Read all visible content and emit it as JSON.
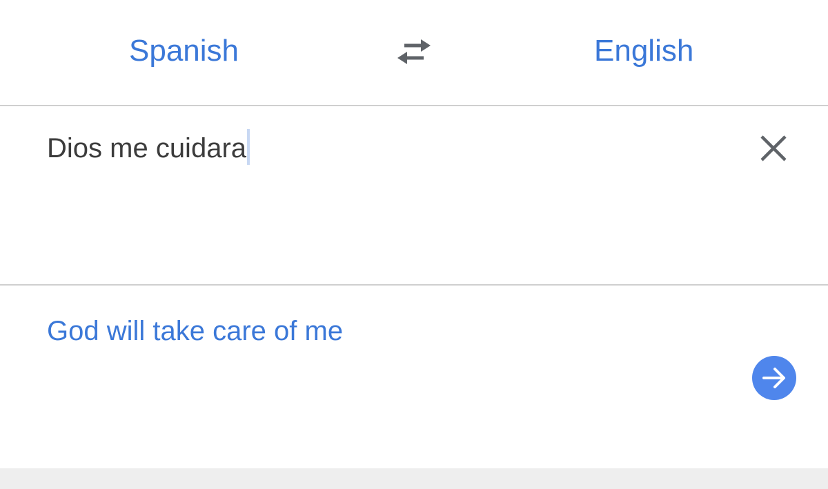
{
  "languages": {
    "source": "Spanish",
    "target": "English"
  },
  "icons": {
    "swap": "swap-arrows-icon",
    "clear": "close-icon",
    "go": "arrow-right-icon"
  },
  "input": {
    "value": "Dios me cuidara"
  },
  "output": {
    "translation": "God will take care of me"
  },
  "colors": {
    "accent": "#3b78d8",
    "go_button": "#4f86ec",
    "input_text": "#3c3c3c",
    "icon_gray": "#5f6368"
  }
}
